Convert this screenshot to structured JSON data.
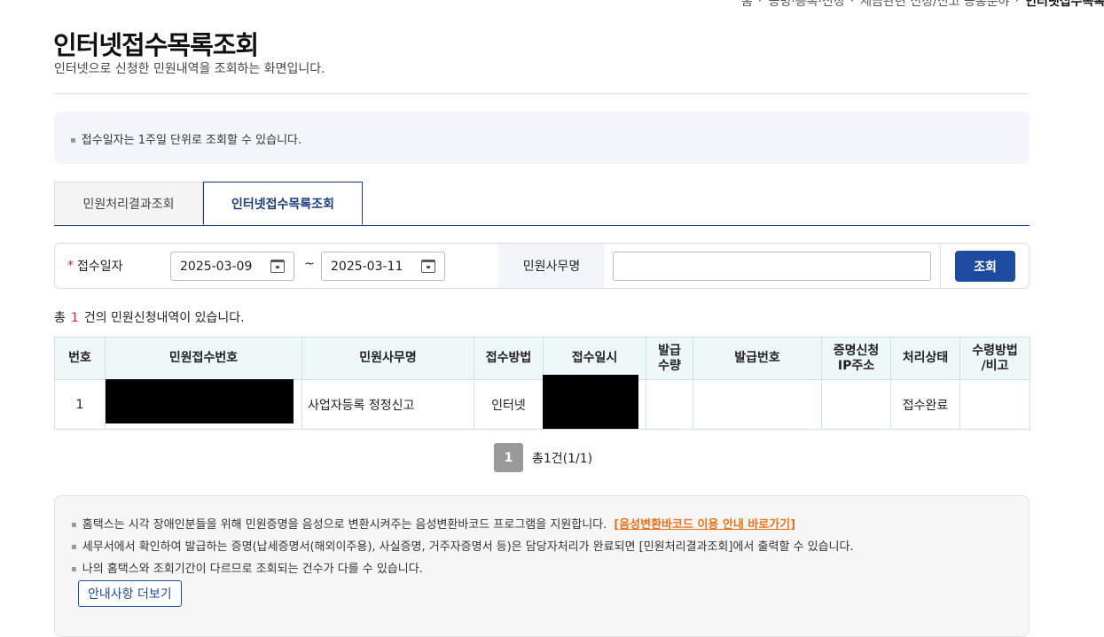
{
  "breadcrumb": {
    "items": [
      "홈",
      "증명·등록·신청",
      "세금관련 신청/신고 공통분야"
    ],
    "current": "인터넷접수목록조회"
  },
  "page": {
    "title": "인터넷접수목록조회",
    "subtitle": "인터넷으로 신청한 민원내역을 조회하는 화면입니다."
  },
  "notice": "접수일자는 1주일 단위로 조회할 수 있습니다.",
  "tabs": [
    {
      "label": "민원처리결과조회",
      "active": false
    },
    {
      "label": "인터넷접수목록조회",
      "active": true
    }
  ],
  "search": {
    "date_label": "접수일자",
    "required_mark": "*",
    "date_from": "2025-03-09",
    "date_to": "2025-03-11",
    "tilde": "~",
    "affair_label": "민원사무명",
    "affair_value": "",
    "button_label": "조회"
  },
  "results": {
    "prefix": "총",
    "count": "1",
    "suffix": "건의 민원신청내역이 있습니다."
  },
  "table": {
    "headers": [
      "번호",
      "민원접수번호",
      "민원사무명",
      "접수방법",
      "접수일시",
      "발급\n수량",
      "발급번호",
      "증명신청\nIP주소",
      "처리상태",
      "수령방법\n/비고"
    ],
    "rows": [
      {
        "no": "1",
        "receipt_no": "",
        "affair": "사업자등록 정정신고",
        "method": "인터넷",
        "datetime": "",
        "qty": "",
        "issue_no": "",
        "ip": "",
        "status": "접수완료",
        "remark": ""
      }
    ]
  },
  "pagination": {
    "current_page": "1",
    "total": "총1건(1/1)"
  },
  "info": {
    "line1": "홈택스는 시각 장애인분들을 위해 민원증명을 음성으로 변환시켜주는 음성변환바코드 프로그램을 지원합니다.",
    "line1_link": "[음성변환바코드 이용 안내 바로가기]",
    "line2": "세무서에서 확인하여 발급하는 증명(납세증명서(해외이주용), 사실증명, 거주자증명서 등)은 담당자처리가 완료되면 [민원처리결과조회]에서 출력할 수 있습니다.",
    "line3": "나의 홈택스와 조회기간이 다르므로 조회되는 건수가 다를 수 있습니다.",
    "more_button": "안내사항 더보기"
  },
  "colors": {
    "primary": "#1c4ba0",
    "tab_border": "#1c3f7c",
    "required": "#d9252a",
    "link": "#e8731a",
    "table_header_bg": "#eef8f7"
  }
}
